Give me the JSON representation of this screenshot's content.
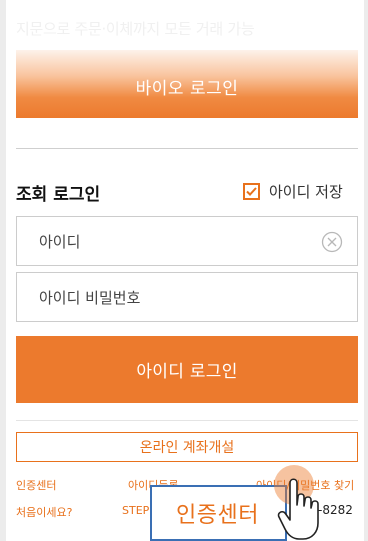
{
  "top_faded_text": "지문으로 주문·이체까지 모든 거래 가능",
  "bio_login": {
    "label": "바이오 로그인"
  },
  "section": {
    "title": "조회 로그인",
    "save_id_label": "아이디 저장",
    "save_id_checked": true
  },
  "fields": {
    "id_placeholder": "아이디",
    "pw_placeholder": "아이디 비밀번호"
  },
  "login_button": {
    "label": "아이디 로그인"
  },
  "account_open_button": {
    "label": "온라인 계좌개설"
  },
  "links": {
    "cert_center": "인증센터",
    "id_register": "아이디등록",
    "find_pw": "아이디/비밀번호 찾기",
    "first_visit": "처음이세요?",
    "step": "STEP"
  },
  "phone_partial": "-8282",
  "tooltip": {
    "label": "인증센터"
  },
  "icons": {
    "checkbox": "check-icon",
    "clear": "clear-circle-x-icon",
    "pointer": "hand-pointer-icon"
  },
  "colors": {
    "accent": "#ec7a2d",
    "accent_text": "#e8711c",
    "tooltip_border": "#3a6fb4"
  }
}
